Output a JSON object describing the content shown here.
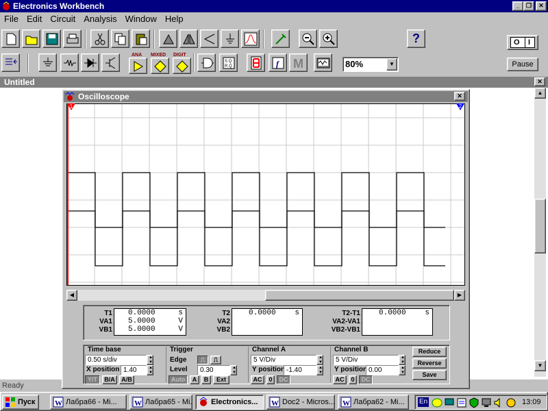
{
  "app": {
    "title": "Electronics Workbench"
  },
  "menu": [
    "File",
    "Edit",
    "Circuit",
    "Analysis",
    "Window",
    "Help"
  ],
  "toolbar": {
    "zoom_value": "80%",
    "help_label": "?",
    "power_label": "O",
    "power_label2": "I",
    "pause_label": "Pause"
  },
  "parts_bin": {
    "ana": "ANA",
    "mixed": "MIXED",
    "digit": "DIGIT"
  },
  "document": {
    "title": "Untitled"
  },
  "osc": {
    "title": "Oscilloscope",
    "cursor1": "1",
    "cursor2": "2",
    "waves": {
      "a": {
        "levels": [
          5,
          -5
        ],
        "period": 80,
        "start_x": 0,
        "first_edge": 41
      },
      "b": {
        "levels": [
          5,
          -5
        ],
        "period": 80,
        "start_x": 0,
        "first_edge": 41
      }
    },
    "readouts": {
      "t1": {
        "label": "T1",
        "value": "0.0000",
        "unit": "s"
      },
      "va1": {
        "label": "VA1",
        "value": "5.0000",
        "unit": "V"
      },
      "vb1": {
        "label": "VB1",
        "value": "5.0000",
        "unit": "V"
      },
      "t2": {
        "label": "T2",
        "value": "0.0000",
        "unit": "s"
      },
      "va2": {
        "label": "VA2"
      },
      "vb2": {
        "label": "VB2"
      },
      "dt": {
        "label": "T2-T1",
        "value": "0.0000",
        "unit": "s"
      },
      "dva": {
        "label": "VA2-VA1"
      },
      "dvb": {
        "label": "VB2-VB1"
      }
    },
    "timebase": {
      "label": "Time base",
      "value": "0.50 s/div",
      "xpos_label": "X position",
      "xpos_value": "1.40",
      "btn_yt": "Y/T",
      "btn_ba": "B/A",
      "btn_ab": "A/B"
    },
    "trigger": {
      "label": "Trigger",
      "edge_label": "Edge",
      "level_label": "Level",
      "level_value": "0.30",
      "btn_auto": "Auto",
      "btn_a": "A",
      "btn_b": "B",
      "btn_ext": "Ext"
    },
    "channel_a": {
      "label": "Channel A",
      "value": "5 V/Div",
      "ypos_label": "Y position",
      "ypos_value": "-1.40",
      "ac": "AC",
      "zero": "0",
      "dc": "DC"
    },
    "channel_b": {
      "label": "Channel B",
      "value": "5 V/Div",
      "ypos_label": "Y position",
      "ypos_value": "0.00",
      "ac": "AC",
      "zero": "0",
      "dc": "DC"
    },
    "buttons": {
      "reduce": "Reduce",
      "reverse": "Reverse",
      "save": "Save"
    }
  },
  "status": {
    "text": "Ready"
  },
  "taskbar": {
    "start": "Пуск",
    "tasks": [
      "Лабра66 - Mi...",
      "Лабра65 - Mi...",
      "Electronics...",
      "Doc2 - Micros...",
      "Лабра62 - Mi..."
    ],
    "lang": "En",
    "time": "13:09"
  },
  "colors": {
    "titlebar": "#000080",
    "trace": "#000000",
    "cursor1": "#ff0000",
    "cursor2": "#0000ff"
  }
}
